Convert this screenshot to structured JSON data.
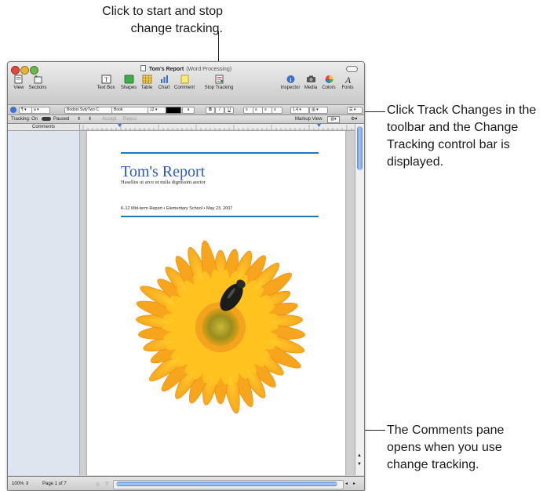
{
  "callouts": {
    "top": "Click to start and stop change tracking.",
    "right": "Click Track Changes in the toolbar and the Change Tracking control bar is displayed.",
    "bottom": "The Comments pane opens when you use change tracking."
  },
  "window": {
    "title": "Tom's Report",
    "subtitle": "(Word Processing)"
  },
  "toolbar": {
    "view": "View",
    "sections": "Sections",
    "text_box": "Text Box",
    "shapes": "Shapes",
    "table": "Table",
    "chart": "Chart",
    "comment": "Comment",
    "stop_tracking": "Stop Tracking",
    "inspector": "Inspector",
    "media": "Media",
    "colors": "Colors",
    "fonts": "Fonts"
  },
  "format_bar": {
    "style": "a",
    "font_family": "Bodoni SvtyTwo C",
    "font_face": "Book",
    "font_size": "12",
    "text_color_letter": "a",
    "bold": "B",
    "italic": "I",
    "underline": "U",
    "line_spacing": "1.4"
  },
  "tracking_bar": {
    "tracking_label": "Tracking: On",
    "paused_label": "Paused",
    "accept": "Accept",
    "reject": "Reject",
    "markup_view": "Markup View"
  },
  "comments_header": "Comments",
  "document": {
    "title": "Tom's Report",
    "subtitle": "Hasellus ut arcu ut nulla dignissim auctor",
    "meta": "K-12 Mid-term Report • Elementary School • May 23, 2007"
  },
  "status": {
    "zoom": "100%",
    "page": "Page 1 of 7"
  },
  "colors": {
    "title_blue": "#2b59c3",
    "rule_blue": "#1e78b5",
    "comments_pane": "#dfe5ee"
  }
}
